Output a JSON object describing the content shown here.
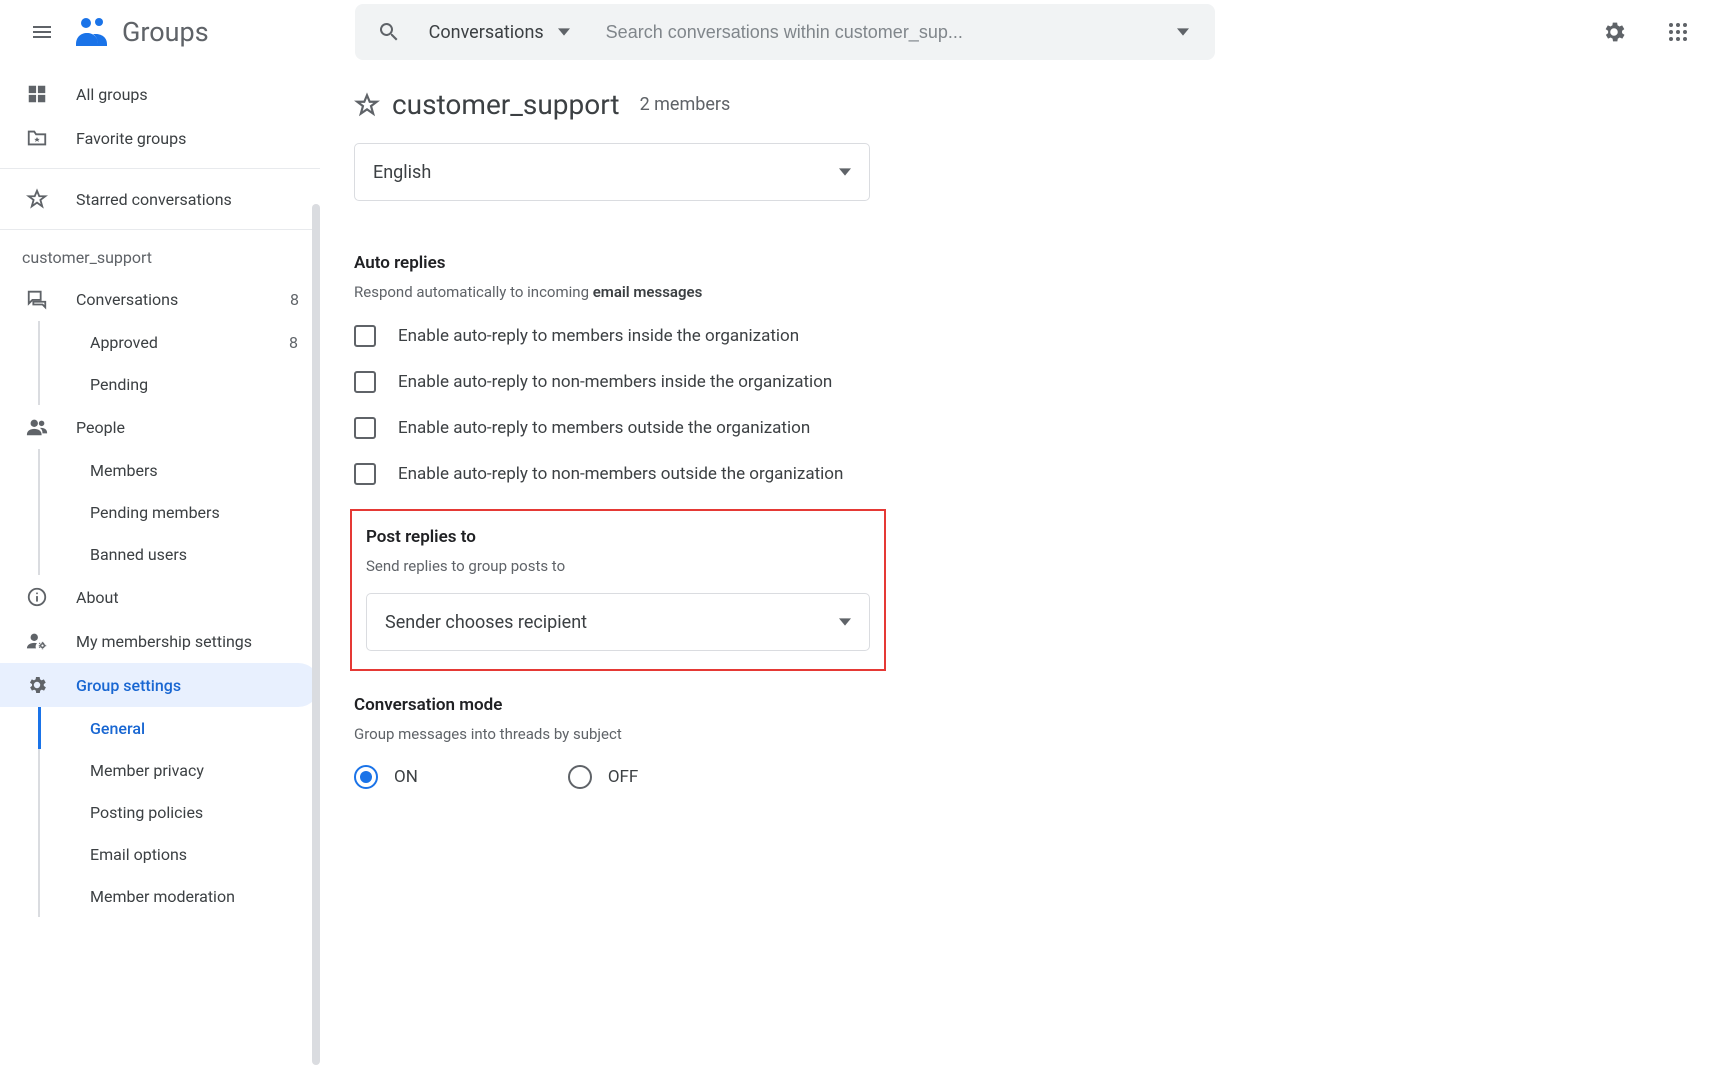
{
  "app_name": "Groups",
  "search": {
    "scope": "Conversations",
    "placeholder": "Search conversations within customer_sup..."
  },
  "sidebar": {
    "all_groups": "All groups",
    "favorite_groups": "Favorite groups",
    "starred": "Starred conversations",
    "group_name": "customer_support",
    "conversations": {
      "label": "Conversations",
      "count": "8"
    },
    "approved": {
      "label": "Approved",
      "count": "8"
    },
    "pending": {
      "label": "Pending"
    },
    "people": "People",
    "members": "Members",
    "pending_members": "Pending members",
    "banned": "Banned users",
    "about": "About",
    "membership": "My membership settings",
    "group_settings": "Group settings",
    "general": "General",
    "privacy": "Member privacy",
    "posting": "Posting policies",
    "email": "Email options",
    "moderation": "Member moderation"
  },
  "main": {
    "group_title": "customer_support",
    "members_count": "2 members",
    "language_select": "English",
    "auto_replies": {
      "title": "Auto replies",
      "subtitle_prefix": "Respond automatically to incoming ",
      "subtitle_bold": "email messages",
      "opts": [
        "Enable auto-reply to members inside the organization",
        "Enable auto-reply to non-members inside the organization",
        "Enable auto-reply to members outside the organization",
        "Enable auto-reply to non-members outside the organization"
      ]
    },
    "post_replies": {
      "title": "Post replies to",
      "subtitle": "Send replies to group posts to",
      "value": "Sender chooses recipient"
    },
    "conversation_mode": {
      "title": "Conversation mode",
      "subtitle": "Group messages into threads by subject",
      "on": "ON",
      "off": "OFF"
    }
  }
}
